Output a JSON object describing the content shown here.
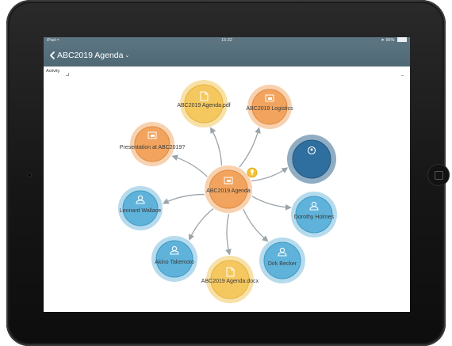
{
  "statusbar": {
    "device": "iPad",
    "time": "15:32",
    "battery_text": "95%",
    "battery_level": 0.95
  },
  "header": {
    "title": "ABC2019 Agenda",
    "dropdown_caret": "⌄"
  },
  "filter": {
    "label": "Activity"
  },
  "icons": {
    "back": "chevron-left-icon",
    "document": "document-icon",
    "presentation": "presentation-icon",
    "person": "person-icon",
    "group": "group-icon",
    "lightbulb": "lightbulb-icon"
  },
  "colors": {
    "header": "#537080",
    "statusbar": "#5b7480",
    "orange": "#f2a45e",
    "yellow": "#f5c85f",
    "light_blue": "#5fb3db",
    "dark_blue": "#2f6f9f",
    "edge": "#9aa4aa"
  },
  "graph": {
    "center": {
      "id": "center",
      "label": "ABC2019 Agenda",
      "kind": "presentation"
    },
    "nodes": [
      {
        "id": "pdf",
        "label": "ABC2019 Agenda.pdf",
        "kind": "document"
      },
      {
        "id": "logistics",
        "label": "ABC2019 Logistics",
        "kind": "presentation"
      },
      {
        "id": "presentation",
        "label": "Presentation at ABC2019?",
        "kind": "presentation"
      },
      {
        "id": "group",
        "label": "",
        "kind": "group"
      },
      {
        "id": "leonard",
        "label": "Leonard Wallace",
        "kind": "person"
      },
      {
        "id": "dorothy",
        "label": "Dorothy Holmes",
        "kind": "person"
      },
      {
        "id": "akino",
        "label": "Akino Takemoto",
        "kind": "person"
      },
      {
        "id": "dirk",
        "label": "Dirk Becker",
        "kind": "person"
      },
      {
        "id": "docx",
        "label": "ABC2019 Agenda.docx",
        "kind": "document"
      }
    ]
  }
}
